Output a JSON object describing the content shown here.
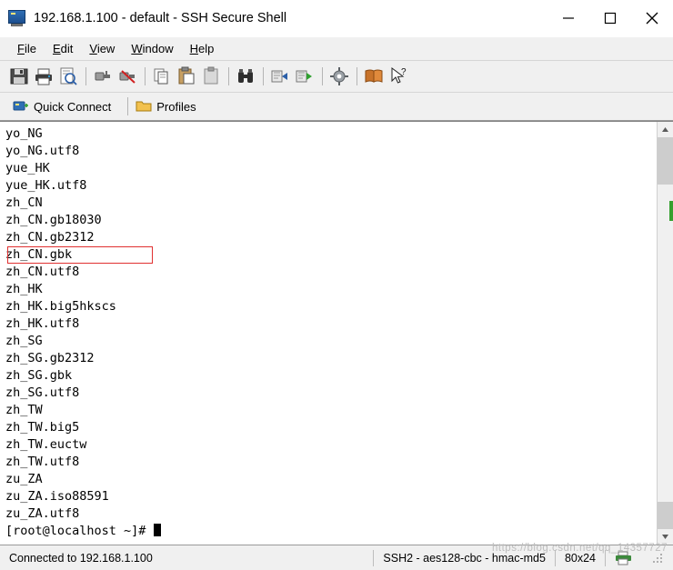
{
  "window": {
    "title": "192.168.1.100 - default - SSH Secure Shell",
    "icon": "ssh-terminal-icon",
    "minimize_label": "─",
    "maximize_label": "☐",
    "close_label": "✕"
  },
  "menu": {
    "items": [
      {
        "label": "File",
        "mnemonic": "F"
      },
      {
        "label": "Edit",
        "mnemonic": "E"
      },
      {
        "label": "View",
        "mnemonic": "V"
      },
      {
        "label": "Window",
        "mnemonic": "W"
      },
      {
        "label": "Help",
        "mnemonic": "H"
      }
    ]
  },
  "toolbar": {
    "buttons": [
      {
        "name": "save-button",
        "icon": "floppy-disk-icon"
      },
      {
        "name": "print-button",
        "icon": "printer-icon"
      },
      {
        "name": "print-preview-button",
        "icon": "print-preview-icon"
      },
      {
        "name": "connect-button",
        "icon": "plug-connect-icon"
      },
      {
        "name": "disconnect-button",
        "icon": "plug-disconnect-icon"
      },
      {
        "name": "copy-button",
        "icon": "copy-icon"
      },
      {
        "name": "paste-button",
        "icon": "paste-icon"
      },
      {
        "name": "paste-plain-button",
        "icon": "clipboard-icon"
      },
      {
        "name": "find-button",
        "icon": "binoculars-icon"
      },
      {
        "name": "file-transfer-button",
        "icon": "file-transfer-icon"
      },
      {
        "name": "new-file-transfer-button",
        "icon": "new-file-transfer-icon"
      },
      {
        "name": "settings-button",
        "icon": "gear-icon"
      },
      {
        "name": "help-book-button",
        "icon": "book-icon"
      },
      {
        "name": "context-help-button",
        "icon": "arrow-question-icon"
      }
    ]
  },
  "connectbar": {
    "quick_connect": "Quick Connect",
    "profiles": "Profiles"
  },
  "terminal": {
    "lines": [
      "yo_NG",
      "yo_NG.utf8",
      "yue_HK",
      "yue_HK.utf8",
      "zh_CN",
      "zh_CN.gb18030",
      "zh_CN.gb2312",
      "zh_CN.gbk",
      "zh_CN.utf8",
      "zh_HK",
      "zh_HK.big5hkscs",
      "zh_HK.utf8",
      "zh_SG",
      "zh_SG.gb2312",
      "zh_SG.gbk",
      "zh_SG.utf8",
      "zh_TW",
      "zh_TW.big5",
      "zh_TW.euctw",
      "zh_TW.utf8",
      "zu_ZA",
      "zu_ZA.iso88591",
      "zu_ZA.utf8"
    ],
    "prompt": "[root@localhost ~]# ",
    "highlight_line_index": 7,
    "highlight_color": "#e03030"
  },
  "statusbar": {
    "connection": "Connected to 192.168.1.100",
    "cipher": "SSH2 - aes128-cbc - hmac-md5",
    "size": "80x24",
    "watermark": "https://blog.csdn.net/qq_14357727"
  }
}
